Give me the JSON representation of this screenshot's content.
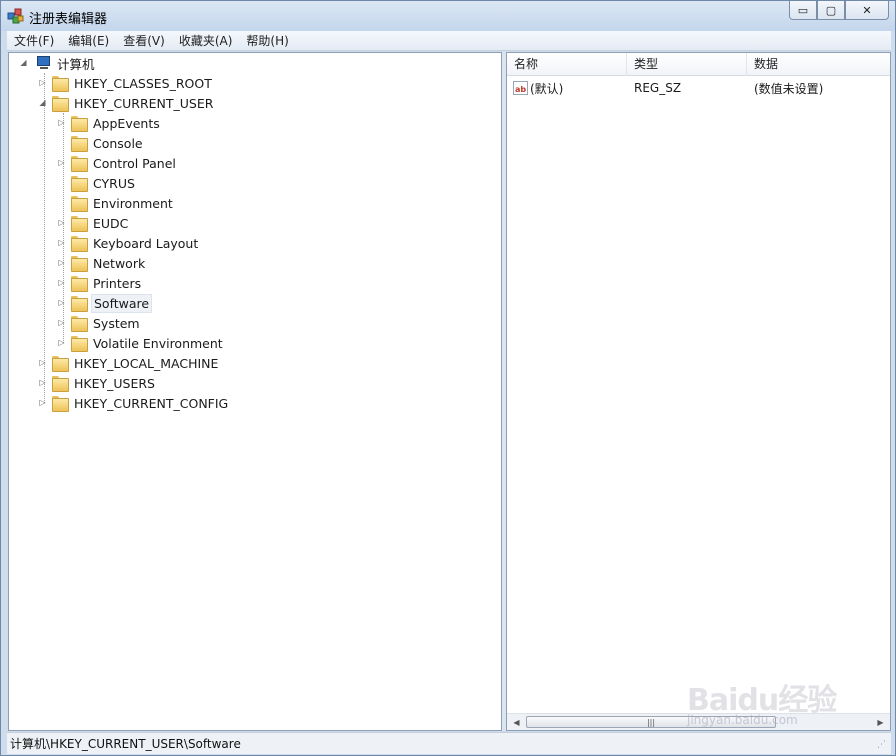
{
  "window": {
    "title": "注册表编辑器",
    "controls": {
      "minimize": "▭",
      "maximize": "▢",
      "close": "✕"
    }
  },
  "menu": [
    "文件(F)",
    "编辑(E)",
    "查看(V)",
    "收藏夹(A)",
    "帮助(H)"
  ],
  "tree": {
    "root": "计算机",
    "hives": {
      "classes_root": "HKEY_CLASSES_ROOT",
      "current_user": "HKEY_CURRENT_USER",
      "local_machine": "HKEY_LOCAL_MACHINE",
      "users": "HKEY_USERS",
      "current_config": "HKEY_CURRENT_CONFIG"
    },
    "current_user_children": [
      "AppEvents",
      "Console",
      "Control Panel",
      "CYRUS",
      "Environment",
      "EUDC",
      "Keyboard Layout",
      "Network",
      "Printers",
      "Software",
      "System",
      "Volatile Environment"
    ],
    "selected": "Software"
  },
  "list": {
    "columns": [
      "名称",
      "类型",
      "数据"
    ],
    "rows": [
      {
        "name": "(默认)",
        "type": "REG_SZ",
        "data": "(数值未设置)",
        "icon": "string-value-icon"
      }
    ]
  },
  "status": {
    "path": "计算机\\HKEY_CURRENT_USER\\Software"
  },
  "watermark": {
    "text": "Baidu经验",
    "sub": "jingyan.baidu.com"
  }
}
